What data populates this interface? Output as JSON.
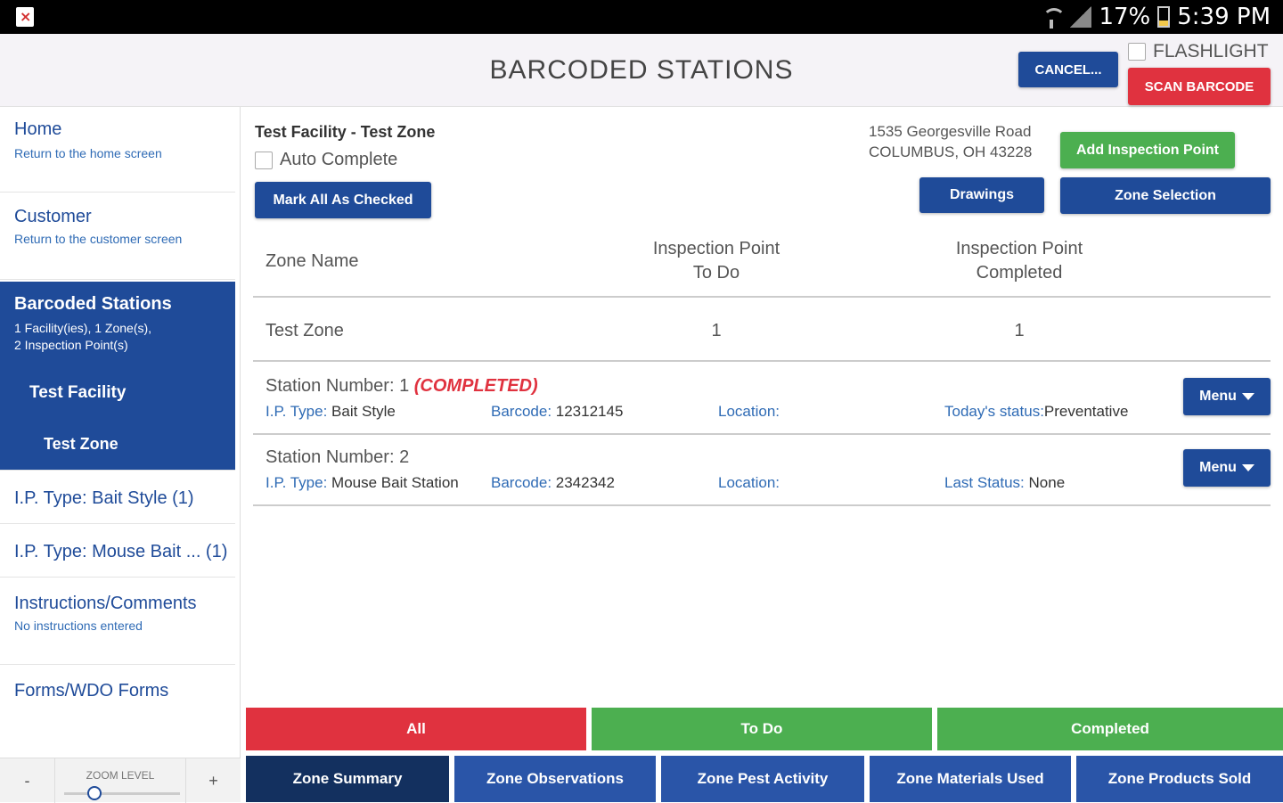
{
  "status_bar": {
    "battery": "17%",
    "time": "5:39 PM"
  },
  "header": {
    "title": "BARCODED STATIONS",
    "cancel_label": "CANCEL...",
    "flashlight_label": "FLASHLIGHT",
    "scan_label": "SCAN BARCODE"
  },
  "sidebar": {
    "home": {
      "title": "Home",
      "sub": "Return to the home screen"
    },
    "customer": {
      "title": "Customer",
      "sub": "Return to the customer screen"
    },
    "barcoded": {
      "title": "Barcoded Stations",
      "sub1": "1 Facility(ies), 1 Zone(s),",
      "sub2": "2 Inspection Point(s)"
    },
    "facility": "Test Facility",
    "zone": "Test Zone",
    "ip_bait": "I.P. Type: Bait Style (1)",
    "ip_mouse": "I.P. Type: Mouse Bait ... (1)",
    "instructions": {
      "title": "Instructions/Comments",
      "sub": "No instructions entered"
    },
    "forms": "Forms/WDO Forms",
    "zoom": {
      "minus": "-",
      "label": "ZOOM LEVEL",
      "plus": "+"
    }
  },
  "main": {
    "facility_zone": "Test Facility - Test Zone",
    "auto_complete_label": "Auto Complete",
    "mark_all_label": "Mark All As Checked",
    "address_line1": "1535 Georgesville Road",
    "address_line2": "COLUMBUS, OH 43228",
    "add_ip_label": "Add Inspection Point",
    "drawings_label": "Drawings",
    "zone_selection_label": "Zone Selection",
    "table": {
      "col_zone": "Zone Name",
      "col_todo_1": "Inspection Point",
      "col_todo_2": "To Do",
      "col_done_1": "Inspection Point",
      "col_done_2": "Completed",
      "row": {
        "zone": "Test Zone",
        "todo": "1",
        "completed": "1"
      }
    },
    "stations": [
      {
        "title": "Station Number: 1",
        "tag": "(COMPLETED)",
        "ip_key": "I.P. Type:",
        "ip_val": " Bait Style",
        "barcode_key": "Barcode:",
        "barcode_val": " 12312145",
        "location_key": "Location:",
        "status_key": "Today's status:",
        "status_val": "Preventative",
        "menu": "Menu"
      },
      {
        "title": "Station Number: 2",
        "ip_key": "I.P. Type:",
        "ip_val": " Mouse Bait Station",
        "barcode_key": "Barcode:",
        "barcode_val": " 2342342",
        "location_key": "Location:",
        "status_key": "Last Status:",
        "status_val": " None",
        "menu": "Menu"
      }
    ]
  },
  "filters": [
    "All",
    "To Do",
    "Completed"
  ],
  "bottom_tabs": [
    "Zone Summary",
    "Zone Observations",
    "Zone Pest Activity",
    "Zone Materials Used",
    "Zone Products Sold"
  ],
  "colors": {
    "brand_blue": "#1f4b99",
    "red": "#e0323f",
    "green": "#4caf50",
    "active_tab": "#13305f"
  }
}
